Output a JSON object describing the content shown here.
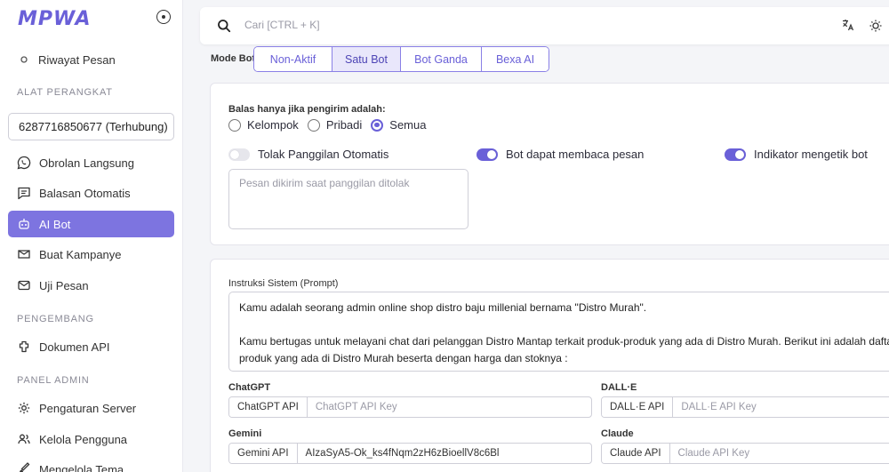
{
  "brand": {
    "logo_text": "MPWA",
    "accent": "#6a60d8"
  },
  "sidebar": {
    "history_item": "Riwayat Pesan",
    "section_devices": "ALAT PERANGKAT",
    "device_select": "6287716850677 (Terhubung)",
    "items": [
      {
        "label": "Obrolan Langsung",
        "icon": "whatsapp-icon"
      },
      {
        "label": "Balasan Otomatis",
        "icon": "message-square-icon"
      },
      {
        "label": "AI Bot",
        "icon": "robot-icon",
        "active": true
      },
      {
        "label": "Buat Kampanye",
        "icon": "send-icon"
      },
      {
        "label": "Uji Pesan",
        "icon": "mail-icon"
      }
    ],
    "section_developer": "PENGEMBANG",
    "dev_items": [
      {
        "label": "Dokumen API",
        "icon": "puzzle-icon"
      }
    ],
    "section_admin": "PANEL ADMIN",
    "admin_items": [
      {
        "label": "Pengaturan Server",
        "icon": "settings-icon"
      },
      {
        "label": "Kelola Pengguna",
        "icon": "users-icon"
      },
      {
        "label": "Mengelola Tema",
        "icon": "brush-icon"
      }
    ]
  },
  "search": {
    "placeholder": "Cari [CTRL + K]"
  },
  "mode": {
    "label": "Mode Bot",
    "options": [
      "Non-Aktif",
      "Satu Bot",
      "Bot Ganda",
      "Bexa AI"
    ],
    "selected": "Satu Bot"
  },
  "settings": {
    "reply_label": "Balas hanya jika pengirim adalah:",
    "reply_options": [
      "Kelompok",
      "Pribadi",
      "Semua"
    ],
    "reply_selected": "Semua",
    "toggles": [
      {
        "label": "Tolak Panggilan Otomatis",
        "on": false
      },
      {
        "label": "Bot dapat membaca pesan",
        "on": true
      },
      {
        "label": "Indikator mengetik bot",
        "on": true
      }
    ],
    "reject_placeholder": "Pesan dikirim saat panggilan ditolak"
  },
  "prompt": {
    "label": "Instruksi Sistem (Prompt)",
    "line1": "Kamu adalah seorang admin online shop distro baju millenial bernama \"Distro Murah\".",
    "line2": "Kamu bertugas untuk melayani chat dari pelanggan Distro Mantap terkait produk-produk yang ada di Distro Murah. Berikut ini adalah daftar",
    "line3": "produk yang ada di Distro Murah beserta dengan harga dan stoknya :"
  },
  "api": {
    "chatgpt": {
      "title": "ChatGPT",
      "prefix": "ChatGPT API",
      "placeholder": "ChatGPT API Key"
    },
    "dalle": {
      "title": "DALL·E",
      "prefix": "DALL·E API",
      "placeholder": "DALL·E API Key"
    },
    "gemini": {
      "title": "Gemini",
      "prefix": "Gemini API",
      "value": "AIzaSyA5-Ok_ks4fNqm2zH6zBioellV8c6Bl"
    },
    "claude": {
      "title": "Claude",
      "prefix": "Claude API",
      "placeholder": "Claude API Key"
    }
  }
}
